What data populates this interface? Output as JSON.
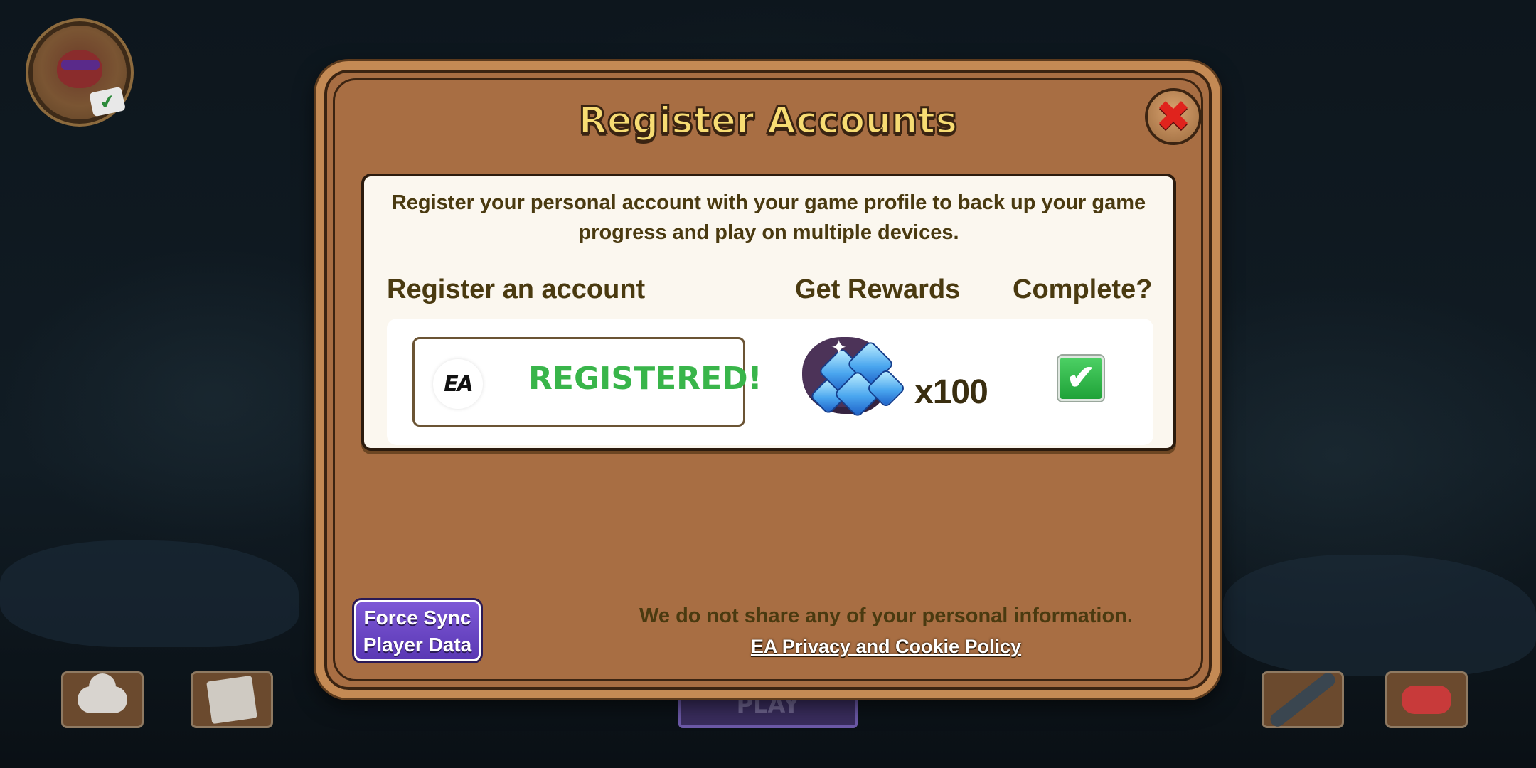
{
  "dialog": {
    "title": "Register Accounts",
    "close_icon": "close-x-icon",
    "description": "Register your personal account with your game profile to back up your game progress and play on multiple devices.",
    "columns": {
      "register": "Register an account",
      "rewards": "Get Rewards",
      "complete": "Complete?"
    },
    "account": {
      "provider_logo": "EA",
      "status": "REGISTERED!"
    },
    "reward": {
      "icon": "gem-bag-icon",
      "quantity": "x100"
    },
    "complete": {
      "checked": true,
      "icon": "checkmark-icon"
    },
    "force_sync": {
      "line1": "Force Sync",
      "line2": "Player Data"
    },
    "privacy_note": "We do not share any of your personal information.",
    "privacy_link": "EA Privacy and Cookie Policy"
  },
  "background": {
    "play_label": "PLAY",
    "bottom_icons": [
      "cloud-icon",
      "newspaper-icon",
      "wrench-icon",
      "gamepad-icon"
    ],
    "avatar_icon": "player-avatar-icon"
  },
  "colors": {
    "dialog_brown": "#a86e43",
    "title_yellow": "#f7dc73",
    "registered_green": "#39b54a",
    "close_red": "#e0231d",
    "force_sync_purple": "#6a46c6"
  }
}
